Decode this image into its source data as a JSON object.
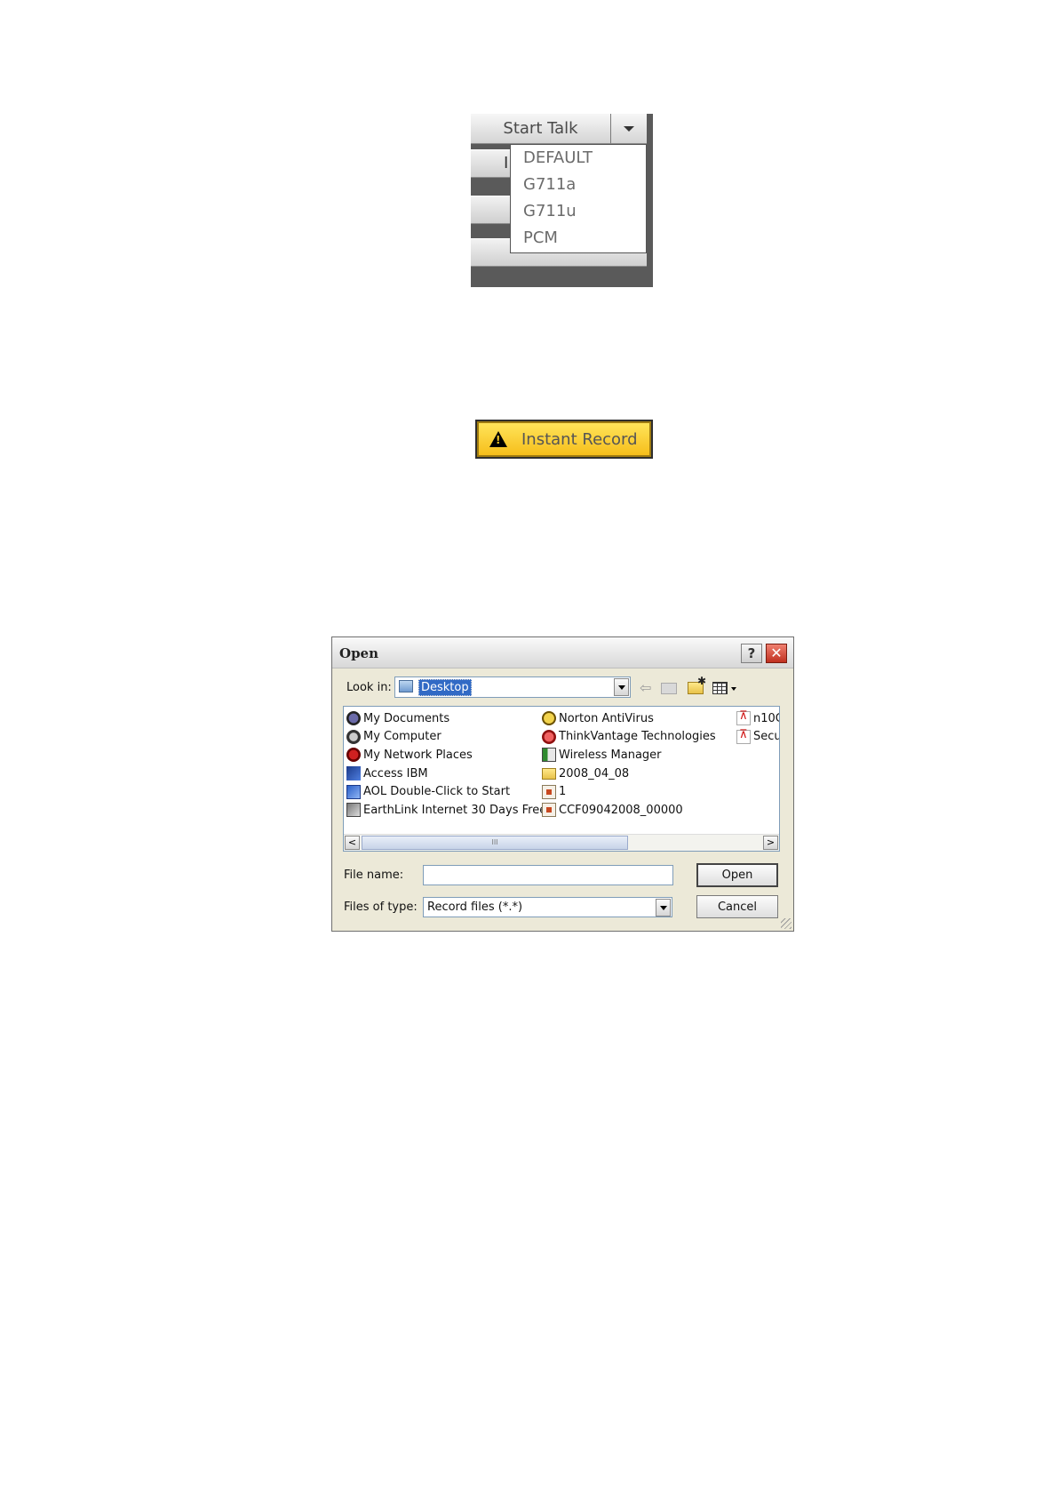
{
  "talk": {
    "button_label": "Start Talk",
    "partial_letter": "I",
    "codecs": [
      "DEFAULT",
      "G711a",
      "G711u",
      "PCM"
    ]
  },
  "instant_record": {
    "label": "Instant Record",
    "warning_mark": "!",
    "accent": "#f9cc2c"
  },
  "dialog": {
    "title": "Open",
    "help_label": "?",
    "close_label": "✕",
    "look_in_label": "Look in:",
    "look_in_value": "Desktop",
    "files": {
      "col1": [
        {
          "name": "My Documents",
          "icon": "my-documents-icon"
        },
        {
          "name": "My Computer",
          "icon": "my-computer-icon"
        },
        {
          "name": "My Network Places",
          "icon": "network-places-icon"
        },
        {
          "name": "Access IBM",
          "icon": "access-ibm-icon"
        },
        {
          "name": "AOL Double-Click to Start",
          "icon": "aol-icon"
        },
        {
          "name": "EarthLink Internet 30 Days Free",
          "icon": "earthlink-icon"
        }
      ],
      "col2": [
        {
          "name": "Norton AntiVirus",
          "icon": "norton-icon"
        },
        {
          "name": "ThinkVantage Technologies",
          "icon": "thinkvantage-icon"
        },
        {
          "name": "Wireless Manager",
          "icon": "wireless-manager-icon"
        },
        {
          "name": "2008_04_08",
          "icon": "folder-icon"
        },
        {
          "name": "1",
          "icon": "record-file-icon"
        },
        {
          "name": "CCF09042008_00000",
          "icon": "record-file-icon"
        }
      ],
      "col3": [
        {
          "name": "n10C",
          "icon": "pdf-icon"
        },
        {
          "name": "Secu",
          "icon": "pdf-icon"
        }
      ]
    },
    "scroll_left": "<",
    "scroll_right": ">",
    "scroll_grip": "III",
    "file_name_label": "File name:",
    "file_name_value": "",
    "files_of_type_label": "Files of type:",
    "files_of_type_value": "Record files (*.*)",
    "open_label": "Open",
    "cancel_label": "Cancel"
  }
}
